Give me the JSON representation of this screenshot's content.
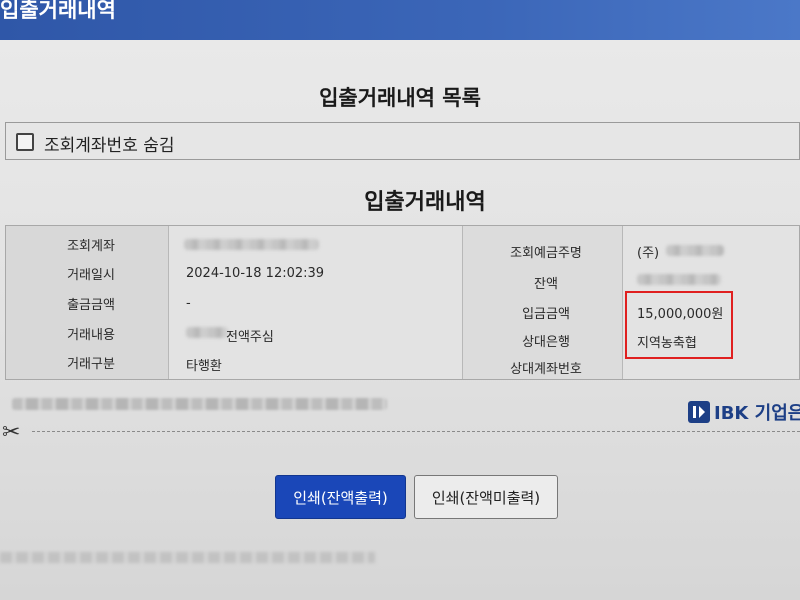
{
  "window": {
    "title": "입출거래내역"
  },
  "list_title": "입출거래내역 목록",
  "hide_account": {
    "label": "조회계좌번호 숨김",
    "checked": false
  },
  "section_title": "입출거래내역",
  "details": {
    "left": [
      {
        "label": "조회계좌",
        "value": ""
      },
      {
        "label": "거래일시",
        "value": "2024-10-18 12:02:39"
      },
      {
        "label": "출금금액",
        "value": "-"
      },
      {
        "label": "거래내용",
        "value": "전액주심"
      },
      {
        "label": "거래구분",
        "value": "타행환"
      }
    ],
    "right": [
      {
        "label": "조회예금주명",
        "value": "(주)"
      },
      {
        "label": "잔액",
        "value": ""
      },
      {
        "label": "입금금액",
        "value": "15,000,000원"
      },
      {
        "label": "상대은행",
        "value": "지역농축협"
      },
      {
        "label": "상대계좌번호",
        "value": ""
      }
    ]
  },
  "logo": {
    "text": "IBK 기업은",
    "mark": "IBK"
  },
  "buttons": {
    "print_with_balance": "인쇄(잔액출력)",
    "print_without_balance": "인쇄(잔액미출력)"
  },
  "colors": {
    "accent": "#1a47b8",
    "titlebar": "#3b66b8",
    "highlight": "#e02020"
  }
}
